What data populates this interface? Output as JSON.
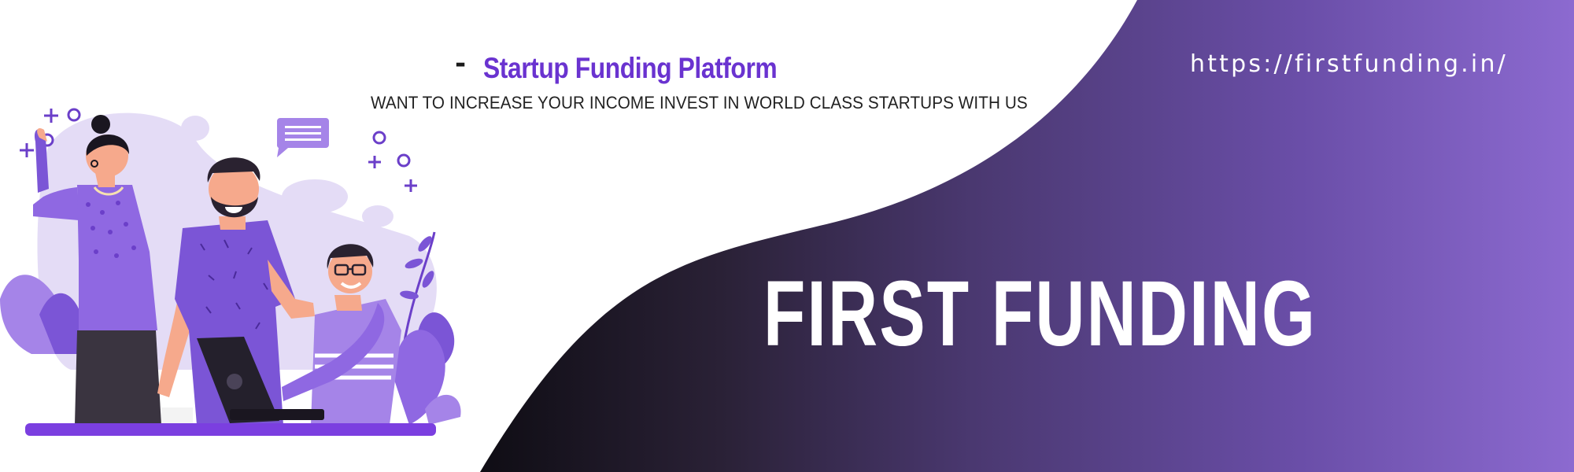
{
  "header": {
    "dash": "-",
    "tagline": "Startup Funding Platform",
    "subline": "WANT TO INCREASE YOUR INCOME INVEST IN WORLD CLASS STARTUPS WITH US",
    "url": "https://firstfunding.in/"
  },
  "hero": {
    "brand_name": "FIRST FUNDING"
  },
  "colors": {
    "accent_purple": "#6a33d0",
    "gradient_dark": "#141118",
    "gradient_light": "#8a66cc",
    "illustration_light": "#e2daf5",
    "illustration_mid": "#a584e8",
    "illustration_dark": "#6b3fc9"
  },
  "icons": [
    "speech-bubble-icon",
    "sparkle-icon",
    "circle-icon",
    "laptop-icon"
  ]
}
